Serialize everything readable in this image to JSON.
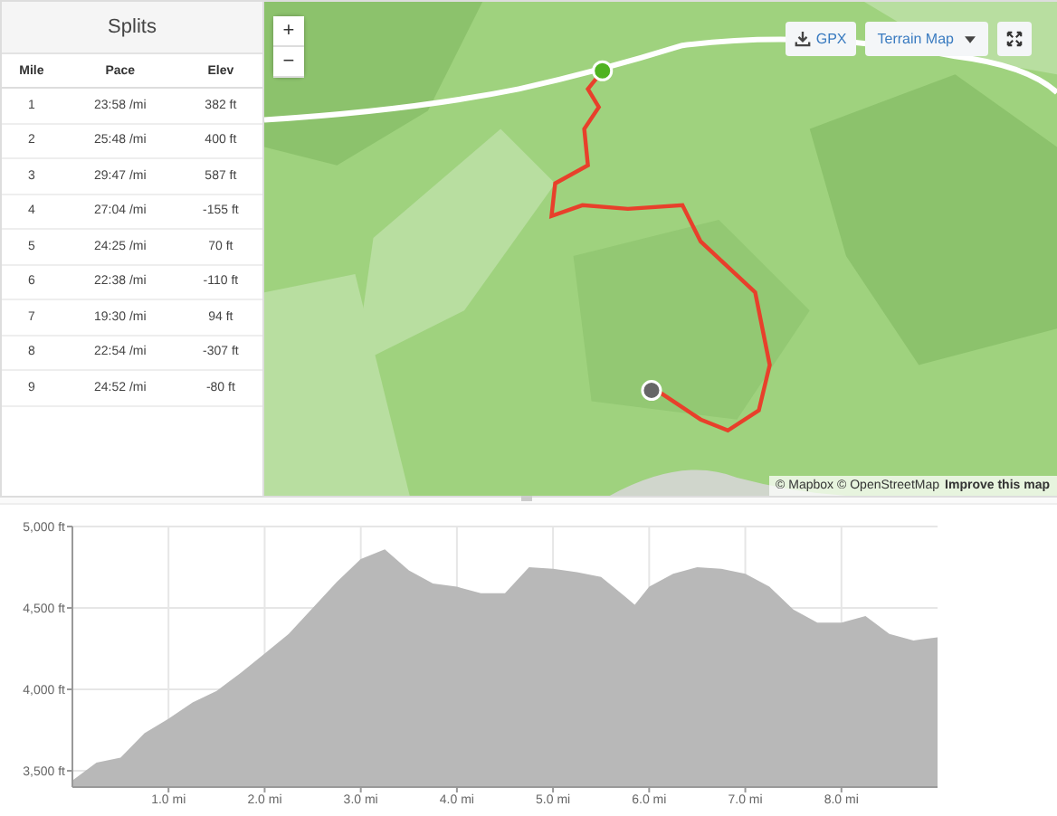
{
  "splits": {
    "title": "Splits",
    "columns": [
      "Mile",
      "Pace",
      "Elev"
    ],
    "rows": [
      [
        "1",
        "23:58 /mi",
        "382 ft"
      ],
      [
        "2",
        "25:48 /mi",
        "400 ft"
      ],
      [
        "3",
        "29:47 /mi",
        "587 ft"
      ],
      [
        "4",
        "27:04 /mi",
        "-155 ft"
      ],
      [
        "5",
        "24:25 /mi",
        "70 ft"
      ],
      [
        "6",
        "22:38 /mi",
        "-110 ft"
      ],
      [
        "7",
        "19:30 /mi",
        "94 ft"
      ],
      [
        "8",
        "22:54 /mi",
        "-307 ft"
      ],
      [
        "9",
        "24:52 /mi",
        "-80 ft"
      ]
    ]
  },
  "map": {
    "zoom_in": "+",
    "zoom_out": "−",
    "gpx_button": "GPX",
    "layer_select": "Terrain Map",
    "attribution": "© Mapbox © OpenStreetMap",
    "improve_link": "Improve this map"
  },
  "elevation": {
    "chart_data": {
      "type": "area",
      "x": [
        0,
        0.25,
        0.5,
        0.75,
        1,
        1.25,
        1.5,
        1.75,
        2,
        2.25,
        2.5,
        2.75,
        3,
        3.25,
        3.5,
        3.75,
        4,
        4.25,
        4.5,
        4.75,
        5,
        5.25,
        5.5,
        5.75,
        5.85,
        6,
        6.25,
        6.5,
        6.75,
        7,
        7.25,
        7.5,
        7.75,
        8,
        8.25,
        8.5,
        8.75,
        9
      ],
      "series": [
        {
          "color": "#b8b8b8",
          "values": [
            3440,
            3550,
            3580,
            3730,
            3820,
            3920,
            3990,
            4100,
            4220,
            4340,
            4500,
            4660,
            4800,
            4860,
            4730,
            4650,
            4630,
            4590,
            4590,
            4750,
            4740,
            4720,
            4690,
            4570,
            4520,
            4630,
            4710,
            4750,
            4740,
            4710,
            4630,
            4490,
            4410,
            4410,
            4450,
            4340,
            4300,
            4320
          ]
        }
      ],
      "grid": true,
      "xlim": [
        0,
        9
      ],
      "ylim": [
        3400,
        5000
      ],
      "xticks": [
        {
          "value": 1,
          "label": "1.0 mi"
        },
        {
          "value": 2,
          "label": "2.0 mi"
        },
        {
          "value": 3,
          "label": "3.0 mi"
        },
        {
          "value": 4,
          "label": "4.0 mi"
        },
        {
          "value": 5,
          "label": "5.0 mi"
        },
        {
          "value": 6,
          "label": "6.0 mi"
        },
        {
          "value": 7,
          "label": "7.0 mi"
        },
        {
          "value": 8,
          "label": "8.0 mi"
        }
      ],
      "yticks": [
        {
          "value": 3500,
          "label": "3,500 ft"
        },
        {
          "value": 4000,
          "label": "4,000 ft"
        },
        {
          "value": 4500,
          "label": "4,500 ft"
        },
        {
          "value": 5000,
          "label": "5,000 ft"
        }
      ]
    }
  }
}
